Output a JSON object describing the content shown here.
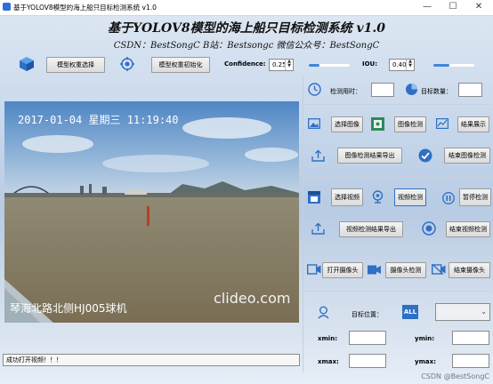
{
  "window": {
    "title": "基于YOLOV8模型的海上船只目标检测系统 v1.0",
    "minimize": "—",
    "maximize": "☐",
    "close": "✕"
  },
  "header": {
    "title": "基于YOLOV8模型的海上船只目标检测系统 v1.0",
    "subtitle": "CSDN：BestSongC   B站：Bestsongc   微信公众号：BestSongC"
  },
  "toolbar": {
    "model_select_label": "模型权重选择",
    "model_init_label": "模型权重初始化",
    "confidence_label": "Confidence:",
    "confidence_value": "0.25",
    "confidence_fraction": 0.25,
    "iou_label": "IOU:",
    "iou_value": "0.40",
    "iou_fraction": 0.4
  },
  "video": {
    "overlay_timestamp": "2017-01-04  星期三  11:19:40",
    "overlay_location": "琴海北路北侧HJ005球机",
    "overlay_watermark": "clideo.com"
  },
  "stats": {
    "time_label": "检测用时：",
    "time_value": "",
    "count_label": "目标数量：",
    "count_value": ""
  },
  "image_panel": {
    "select_label": "选择图像",
    "detect_label": "图像检测",
    "show_label": "结果展示",
    "export_label": "图像检测结果导出",
    "finish_label": "结束图像检测"
  },
  "video_panel": {
    "select_label": "选择视频",
    "detect_label": "视频检测",
    "pause_label": "暂停检测",
    "export_label": "视频检测结果导出",
    "finish_label": "结束视频检测"
  },
  "camera_panel": {
    "open_label": "打开摄像头",
    "detect_label": "摄像头检测",
    "finish_label": "结束摄像头"
  },
  "target": {
    "position_label": "目标位置：",
    "all_badge": "ALL",
    "select_value": "",
    "xmin_label": "xmin:",
    "ymin_label": "ymin:",
    "xmax_label": "xmax:",
    "ymax_label": "ymax:",
    "xmin_value": "",
    "ymin_value": "",
    "xmax_value": "",
    "ymax_value": ""
  },
  "status": {
    "message": "成功打开视频！！！"
  },
  "footer": {
    "watermark": "CSDN @BestSongC"
  },
  "colors": {
    "accent": "#3e86d8",
    "icon_blue": "#2f6fc4"
  }
}
